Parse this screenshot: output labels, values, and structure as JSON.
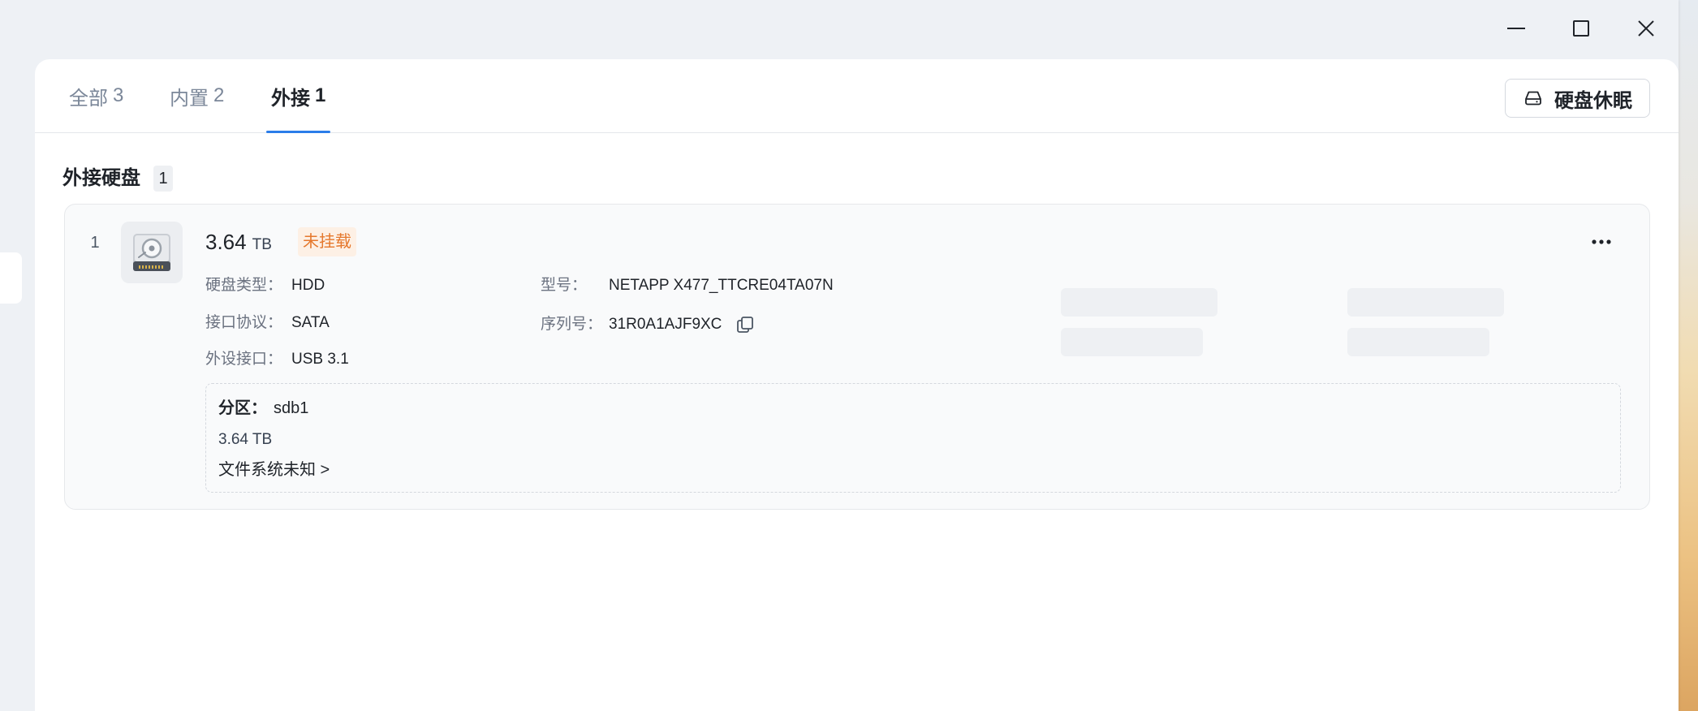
{
  "window_controls": {
    "minimize_icon": "minimize-icon",
    "maximize_icon": "maximize-icon",
    "close_icon": "close-icon"
  },
  "tabs": [
    {
      "label": "全部",
      "count": "3",
      "active": false
    },
    {
      "label": "内置",
      "count": "2",
      "active": false
    },
    {
      "label": "外接",
      "count": "1",
      "active": true
    }
  ],
  "toolbar": {
    "sleep_button": {
      "icon": "hard-drive-icon",
      "label": "硬盘休眠"
    }
  },
  "section": {
    "title": "外接硬盘",
    "count": "1"
  },
  "disks": [
    {
      "index": "1",
      "icon": "hard-disk-icon",
      "capacity": {
        "value": "3.64",
        "unit": "TB"
      },
      "status": "未挂载",
      "more_icon": "more-horizontal-icon",
      "details": {
        "disk_type": {
          "label": "硬盘类型：",
          "value": "HDD"
        },
        "protocol": {
          "label": "接口协议：",
          "value": "SATA"
        },
        "port": {
          "label": "外设接口：",
          "value": "USB 3.1"
        },
        "model": {
          "label": "型号：",
          "value": "NETAPP X477_TTCRE04TA07N"
        },
        "serial": {
          "label": "序列号：",
          "value": "31R0A1AJF9XC",
          "copy_icon": "copy-icon"
        }
      },
      "partitions": [
        {
          "label": "分区：",
          "name": "sdb1",
          "size": "3.64 TB",
          "filesystem_link": "文件系统未知 >"
        }
      ]
    }
  ],
  "colors": {
    "accent": "#2b7de9",
    "status_text": "#e5782d",
    "status_bg": "#fdf0e5",
    "text_primary": "#1f2329",
    "text_secondary": "#6b7280",
    "skeleton": "#eef0f3"
  }
}
